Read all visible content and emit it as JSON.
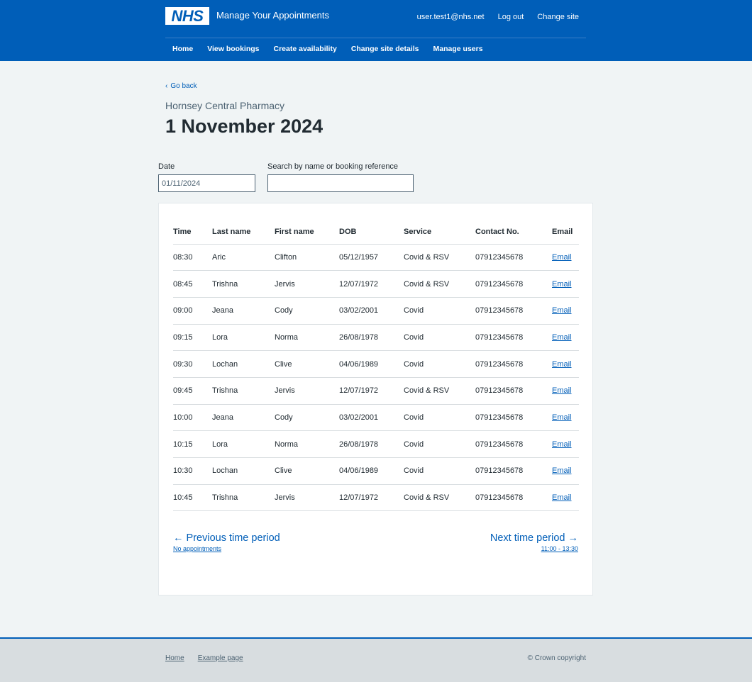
{
  "header": {
    "logo": "NHS",
    "service_name": "Manage Your Appointments",
    "user": "user.test1@nhs.net",
    "logout": "Log out",
    "change_site": "Change site",
    "nav": [
      "Home",
      "View bookings",
      "Create availability",
      "Change site details",
      "Manage users"
    ],
    "colors": {
      "brand": "#005eb8",
      "background": "#f0f4f5",
      "link": "#005eb8"
    }
  },
  "page": {
    "back_label": "Go back",
    "site_name": "Hornsey Central Pharmacy",
    "title": "1 November 2024"
  },
  "filters": {
    "date_label": "Date",
    "date_value": "01/11/2024",
    "search_label": "Search by name or booking reference",
    "search_value": ""
  },
  "table": {
    "headers": [
      "Time",
      "Last name",
      "First name",
      "DOB",
      "Service",
      "Contact No.",
      "Email"
    ],
    "rows": [
      [
        "08:30",
        "Aric",
        "Clifton",
        "05/12/1957",
        "Covid & RSV",
        "07912345678",
        "Email"
      ],
      [
        "08:45",
        "Trishna",
        "Jervis",
        "12/07/1972",
        "Covid & RSV",
        "07912345678",
        "Email"
      ],
      [
        "09:00",
        "Jeana",
        "Cody",
        "03/02/2001",
        "Covid",
        "07912345678",
        "Email"
      ],
      [
        "09:15",
        "Lora",
        "Norma",
        "26/08/1978",
        "Covid",
        "07912345678",
        "Email"
      ],
      [
        "09:30",
        "Lochan",
        "Clive",
        "04/06/1989",
        "Covid",
        "07912345678",
        "Email"
      ],
      [
        "09:45",
        "Trishna",
        "Jervis",
        "12/07/1972",
        "Covid & RSV",
        "07912345678",
        "Email"
      ],
      [
        "10:00",
        "Jeana",
        "Cody",
        "03/02/2001",
        "Covid",
        "07912345678",
        "Email"
      ],
      [
        "10:15",
        "Lora",
        "Norma",
        "26/08/1978",
        "Covid",
        "07912345678",
        "Email"
      ],
      [
        "10:30",
        "Lochan",
        "Clive",
        "04/06/1989",
        "Covid",
        "07912345678",
        "Email"
      ],
      [
        "10:45",
        "Trishna",
        "Jervis",
        "12/07/1972",
        "Covid & RSV",
        "07912345678",
        "Email"
      ]
    ]
  },
  "pagination": {
    "prev_label": "Previous time period",
    "prev_sub": "No appointments",
    "next_label": "Next time period",
    "next_sub": "11:00 - 13:30"
  },
  "footer": {
    "links": [
      "Home",
      "Example page"
    ],
    "copyright": "© Crown copyright"
  }
}
